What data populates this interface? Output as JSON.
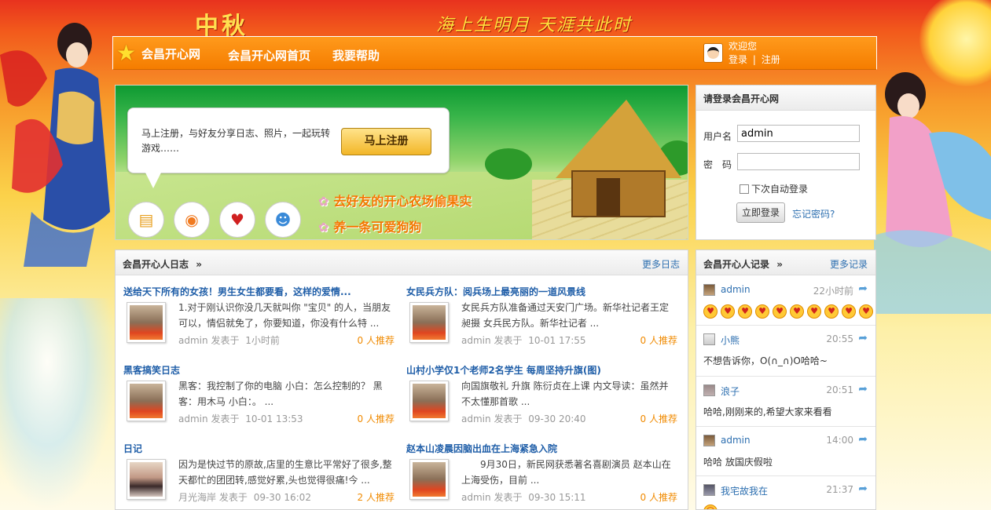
{
  "header": {
    "festival_title": "中秋",
    "slogan": "海上生明月 天涯共此时"
  },
  "topbar": {
    "logo_text": "会昌开心网",
    "nav_home": "会昌开心网首页",
    "nav_help": "我要帮助",
    "welcome": "欢迎您",
    "login_link": "登录",
    "separator": "|",
    "register_link": "注册"
  },
  "banner": {
    "bubble_text": "马上注册，与好友分享日志、照片，一起玩转游戏……",
    "register_button": "马上注册",
    "slogan1": "去好友的开心农场偷果实",
    "slogan2": "养一条可爱狗狗",
    "icons": [
      "message-icon",
      "camera-icon",
      "cards-icon",
      "people-icon"
    ]
  },
  "login": {
    "title": "请登录会昌开心网",
    "username_label": "用户名",
    "username_value": "admin",
    "password_label": "密　码",
    "password_value": "",
    "remember_label": "下次自动登录",
    "submit_label": "立即登录",
    "forgot_label": "忘记密码?"
  },
  "blog": {
    "title": "会昌开心人日志",
    "arrow": "»",
    "more": "更多日志",
    "posts": [
      {
        "title": "送给天下所有的女孩！男生女生都要看，这样的爱情...",
        "body": "1.对于刚认识你没几天就叫你 \"宝贝\" 的人，当朋友可以，情侣就免了，你要知道，你没有什么特 ...",
        "author": "admin",
        "action": "发表于",
        "time": "1小时前",
        "rec": "0 人推荐"
      },
      {
        "title": "女民兵方队：阅兵场上最亮丽的一道风景线",
        "body": "女民兵方队准备通过天安门广场。新华社记者王定昶摄 女兵民方队。新华社记者 ...",
        "author": "admin",
        "action": "发表于",
        "time": "10-01 17:55",
        "rec": "0 人推荐"
      },
      {
        "title": "黑客搞笑日志",
        "body": "黑客：我控制了你的电脑 小白：怎么控制的？ 黑客：用木马 小白：。 ...",
        "author": "admin",
        "action": "发表于",
        "time": "10-01 13:53",
        "rec": "0 人推荐"
      },
      {
        "title": "山村小学仅1个老师2名学生 每周坚持升旗(图)",
        "body": "向国旗敬礼 升旗 陈衍贞在上课 内文导读：虽然并不太懂那首歌 ...",
        "author": "admin",
        "action": "发表于",
        "time": "09-30 20:40",
        "rec": "0 人推荐"
      },
      {
        "title": "日记",
        "body": "因为是快过节的原故,店里的生意比平常好了很多,整天都忙的团团转,感觉好累,头也觉得很痛!今 ...",
        "author": "月光海岸",
        "action": "发表于",
        "time": "09-30 16:02",
        "rec": "2 人推荐"
      },
      {
        "title": "赵本山凌晨因脑出血在上海紧急入院",
        "body": "　　9月30日，新民网获悉著名喜剧演员 赵本山在上海受伤，目前 ...",
        "author": "admin",
        "action": "发表于",
        "time": "09-30 15:11",
        "rec": "0 人推荐"
      }
    ]
  },
  "records": {
    "title": "会昌开心人记录",
    "arrow": "»",
    "more": "更多记录",
    "items": [
      {
        "name": "admin",
        "time": "22小时前",
        "content": ""
      },
      {
        "name": "小熊",
        "time": "20:55",
        "content": "不想告诉你，O(∩_∩)O哈哈~"
      },
      {
        "name": "浪子",
        "time": "20:51",
        "content": "哈哈,刚刚来的,希望大家来看看"
      },
      {
        "name": "admin",
        "time": "14:00",
        "content": "哈哈 放国庆假啦"
      },
      {
        "name": "我宅故我在",
        "time": "21:37",
        "content": ""
      }
    ]
  }
}
